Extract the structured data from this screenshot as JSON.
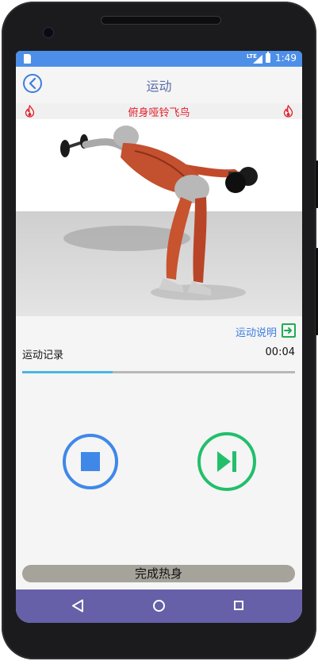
{
  "status_bar": {
    "time": "1:49",
    "network": "LTE"
  },
  "app_bar": {
    "title": "运动",
    "back_icon": "back-arrow-circle-icon"
  },
  "exercise": {
    "name": "俯身哑铃飞鸟",
    "left_icon": "flame-icon",
    "right_icon": "flame-icon"
  },
  "instructions": {
    "label": "运动说明",
    "icon": "arrow-right-box-icon"
  },
  "record": {
    "label": "运动记录",
    "timer": "00:04",
    "progress": 0.33
  },
  "controls": {
    "stop_icon": "stop-icon",
    "next_icon": "skip-next-icon"
  },
  "finish_button": {
    "label": "完成热身"
  },
  "colors": {
    "accent": "#3b7de0",
    "status_bar": "#4d8fe8",
    "nav_bar": "#6560a8",
    "exercise_name": "#e0202a",
    "next_button": "#22bf6b",
    "progress": "#49b6e4",
    "finish_button": "#a5a39a"
  }
}
